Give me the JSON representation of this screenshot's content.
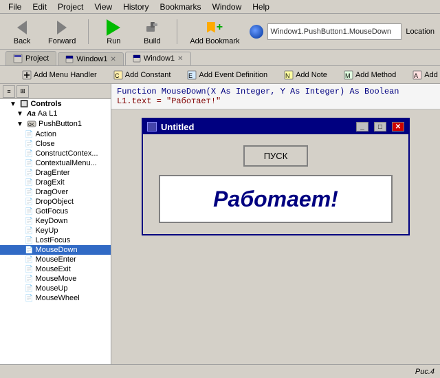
{
  "menubar": {
    "items": [
      "File",
      "Edit",
      "Project",
      "View",
      "History",
      "Bookmarks",
      "Window",
      "Help"
    ]
  },
  "toolbar": {
    "back_label": "Back",
    "forward_label": "Forward",
    "run_label": "Run",
    "build_label": "Build",
    "add_bookmark_label": "Add Bookmark",
    "location_label": "Location",
    "location_value": ""
  },
  "tabs": [
    {
      "label": "Project",
      "active": false
    },
    {
      "label": "Window1",
      "active": false
    },
    {
      "label": "Window1",
      "active": true
    }
  ],
  "toolbar2": {
    "buttons": [
      "Add Menu Handler",
      "Add Constant",
      "Add Event Definition",
      "Add Note",
      "Add Method",
      "Add"
    ]
  },
  "code": {
    "line1": "Function MouseDown(X As Integer, Y As Integer) As Boolean",
    "line2": "L1.text = \"Работает!\""
  },
  "left_panel": {
    "section_label": "Controls",
    "tree": {
      "root": "Aa L1",
      "selected_parent": "PushButton1",
      "items": [
        "Action",
        "Close",
        "ConstructContex...",
        "ContextualMenu...",
        "DragEnter",
        "DragExit",
        "DragOver",
        "DropObject",
        "GotFocus",
        "KeyDown",
        "KeyUp",
        "LostFocus",
        "MouseDown",
        "MouseEnter",
        "MouseExit",
        "MouseMove",
        "MouseUp",
        "MouseWheel"
      ]
    }
  },
  "preview": {
    "title": "Untitled",
    "button_label": "ПУСК",
    "label_text": "Работает!",
    "win_btns": [
      "_",
      "□",
      "✕"
    ]
  },
  "statusbar": {
    "caption": "Рис.4"
  }
}
